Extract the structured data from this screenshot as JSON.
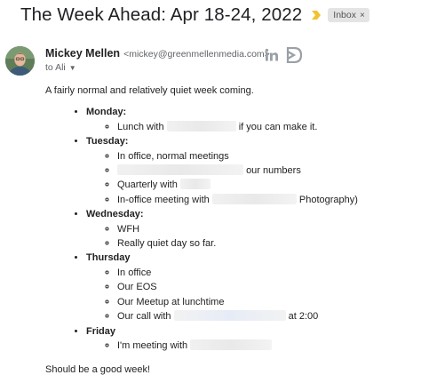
{
  "subject": "The Week Ahead: Apr 18-24, 2022",
  "label_chip": {
    "label": "Inbox",
    "remove": "×"
  },
  "colors": {
    "importance_marker": "#f2c230",
    "chip_bg": "#e4e4e4"
  },
  "sender": {
    "name": "Mickey Mellen",
    "email": "<mickey@greenmellenmedia.com>",
    "to_line": "to Ali",
    "icons": [
      "linkedin-icon",
      "brand-logo-icon",
      "show-details-caret-icon"
    ]
  },
  "body": {
    "intro": "A fairly normal and relatively quiet week coming.",
    "days": [
      {
        "name": "Monday:",
        "items": [
          {
            "before": "Lunch with",
            "redacted": true,
            "after": "if you can make it."
          }
        ]
      },
      {
        "name": "Tuesday:",
        "items": [
          {
            "before": "In office, normal meetings"
          },
          {
            "before": "",
            "redacted": true,
            "after": "our numbers"
          },
          {
            "before": "Quarterly with",
            "redacted": true,
            "after": ""
          },
          {
            "before": "In-office meeting with",
            "redacted": true,
            "after": "Photography)"
          }
        ]
      },
      {
        "name": "Wednesday:",
        "items": [
          {
            "before": "WFH"
          },
          {
            "before": "Really quiet day so far."
          }
        ]
      },
      {
        "name": "Thursday",
        "items": [
          {
            "before": "In office"
          },
          {
            "before": "Our EOS"
          },
          {
            "before": "Our Meetup at lunchtime"
          },
          {
            "before": "Our call with",
            "redacted": true,
            "after": "at 2:00"
          }
        ]
      },
      {
        "name": "Friday",
        "items": [
          {
            "before": "I'm meeting with",
            "redacted": true,
            "after": ""
          }
        ]
      }
    ],
    "outro": "Should be a good week!"
  }
}
